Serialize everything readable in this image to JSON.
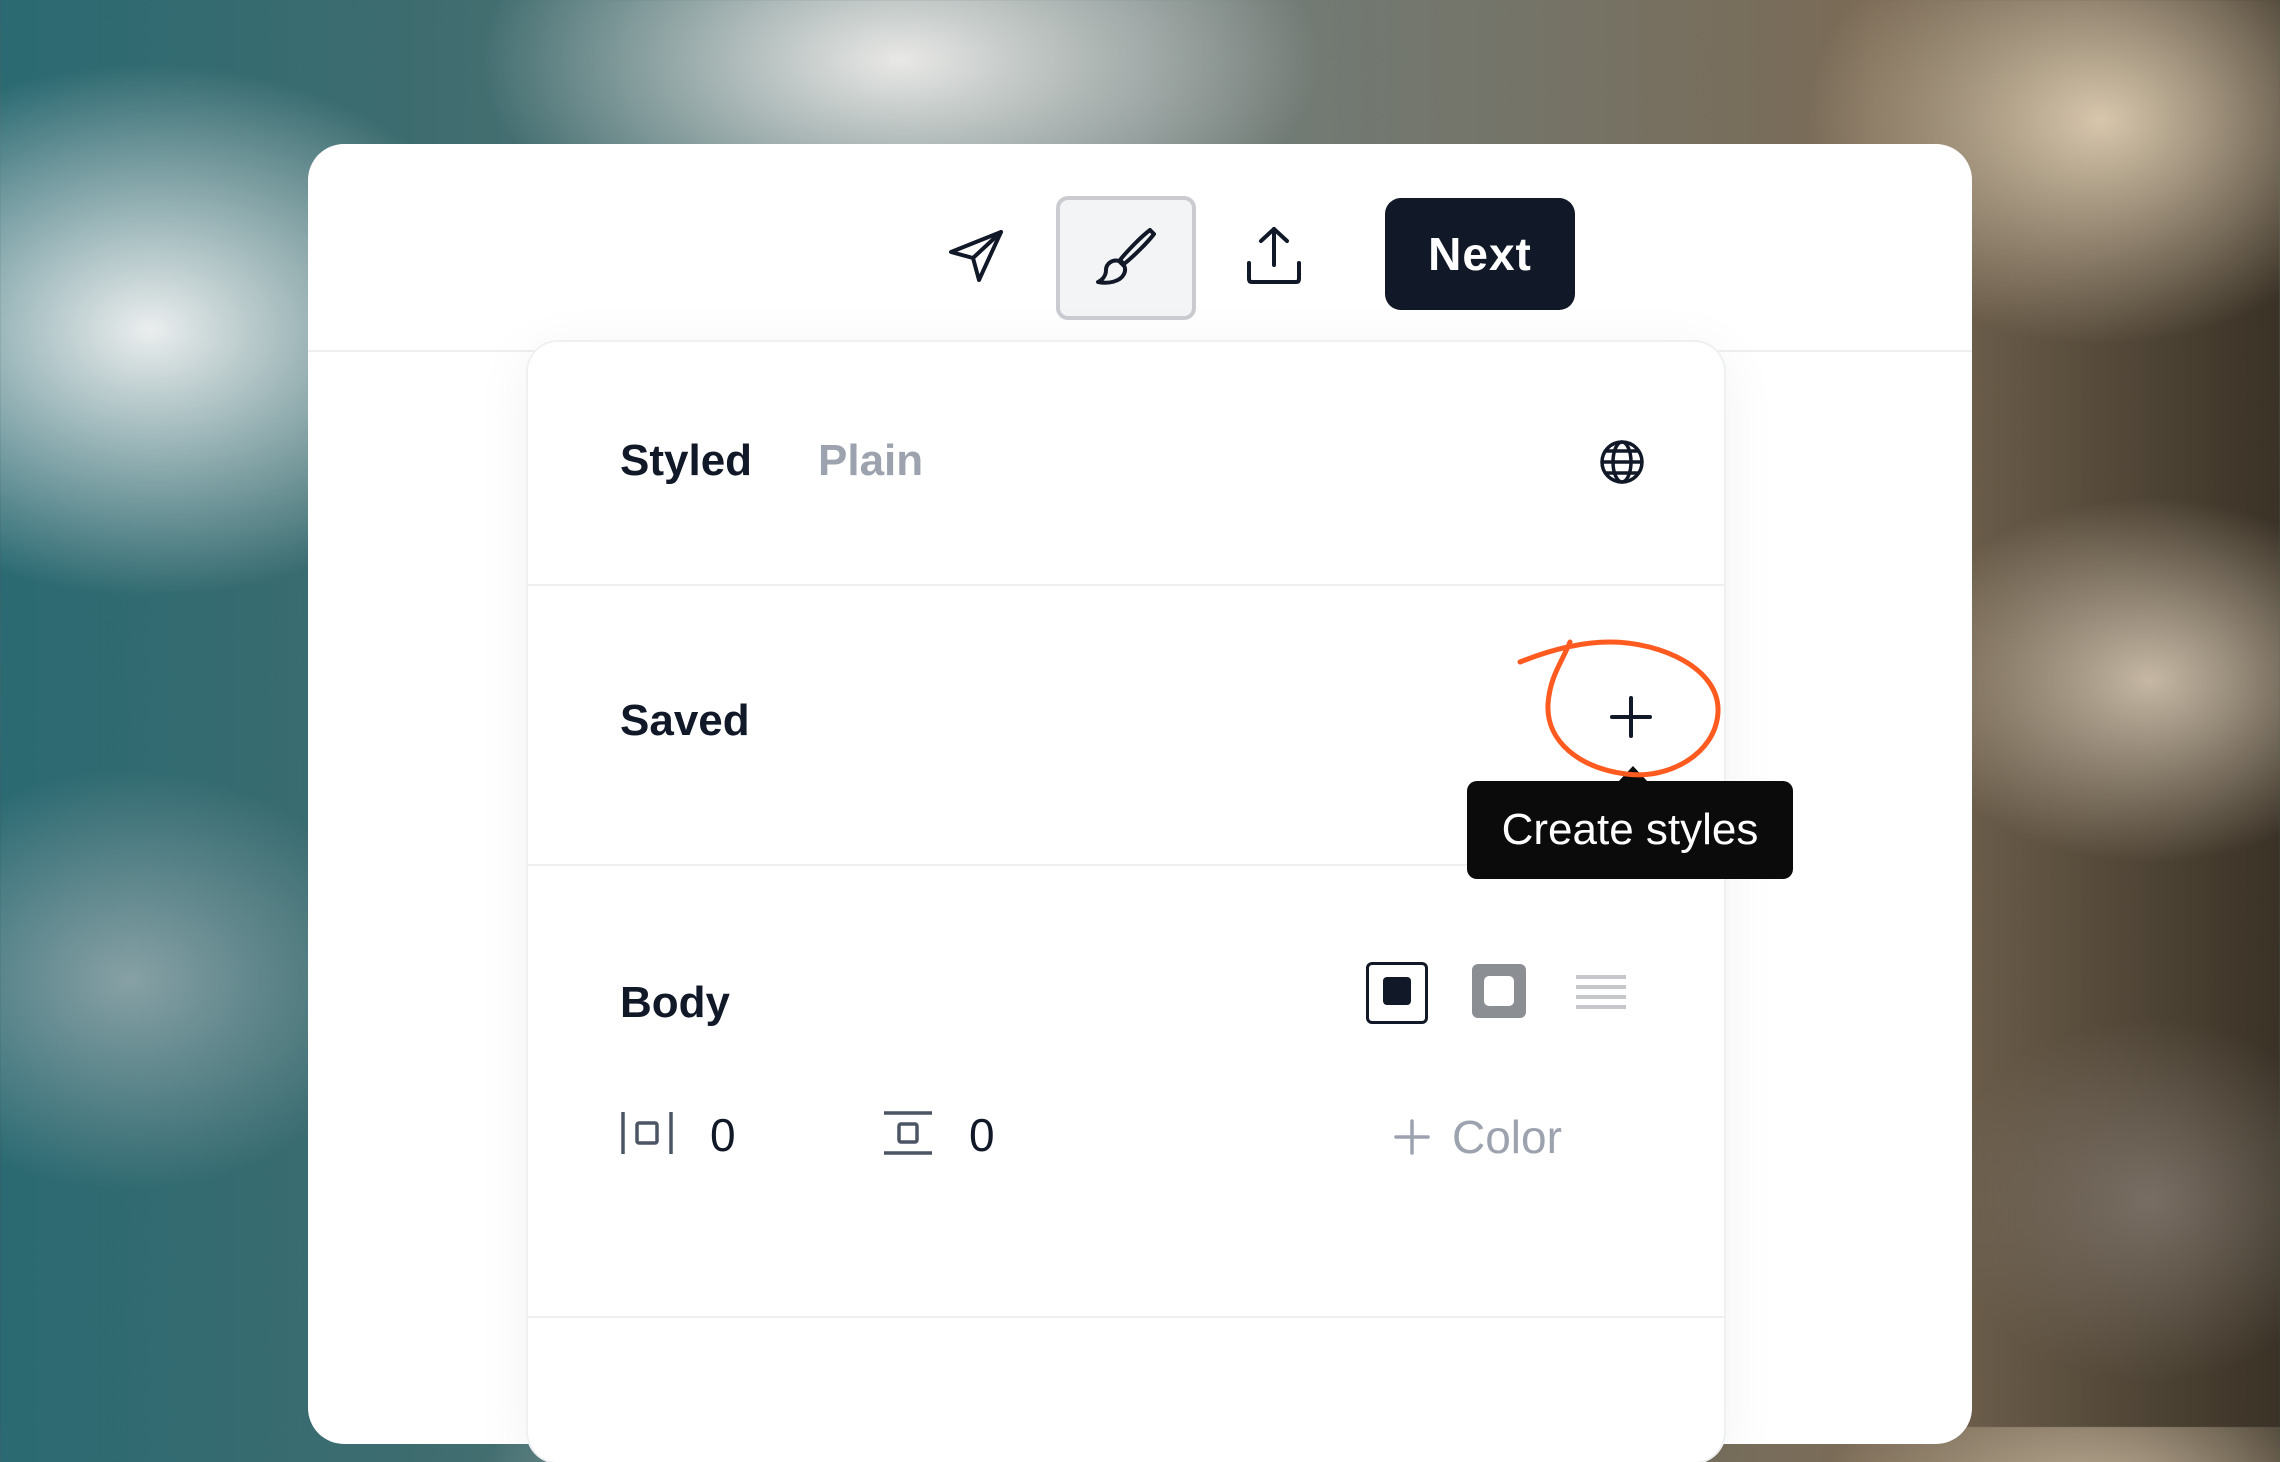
{
  "toolbar": {
    "icons": [
      "send-icon",
      "paintbrush-icon",
      "upload-icon"
    ],
    "active_tool": "paintbrush-icon",
    "next_label": "Next"
  },
  "panel": {
    "tabs": {
      "styled": "Styled",
      "plain": "Plain",
      "selected": "Styled"
    },
    "globe_icon": "globe-icon",
    "saved": {
      "title": "Saved",
      "add_icon": "plus-icon",
      "tooltip": "Create styles"
    },
    "body": {
      "title": "Body",
      "style_options": [
        "filled-square-icon",
        "outlined-square-icon",
        "lines-icon"
      ],
      "horizontal_padding": "0",
      "vertical_padding": "0",
      "add_color_label": "Color"
    }
  },
  "colors": {
    "primary": "#111827",
    "muted": "#9ca3af",
    "annotation": "#ff5a1f",
    "tooltip_bg": "#0b0b0b"
  }
}
